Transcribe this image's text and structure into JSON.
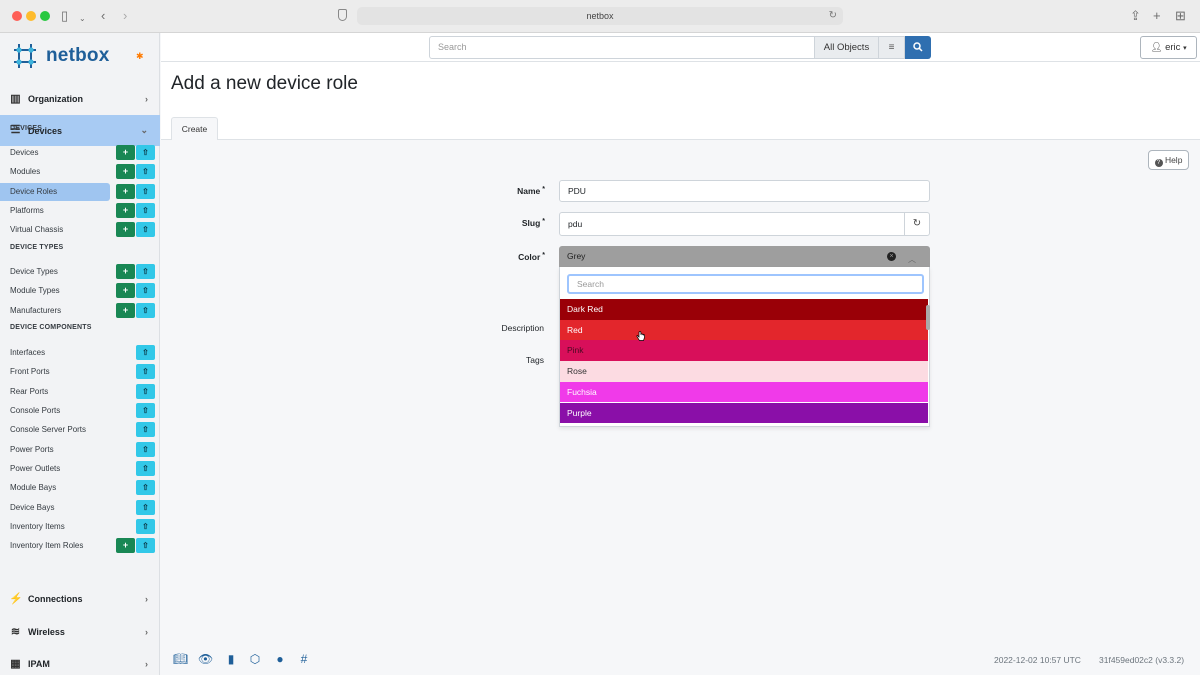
{
  "browser": {
    "url": "netbox",
    "icons": [
      "sidebar-toggle-icon",
      "back-icon",
      "forward-icon",
      "share-icon",
      "new-tab-icon",
      "tabs-overview-icon"
    ]
  },
  "logo": {
    "text": "netbox"
  },
  "sidebar": {
    "organization": "Organization",
    "devices": "Devices",
    "connections": "Connections",
    "wireless": "Wireless",
    "ipam": "IPAM",
    "sections": [
      {
        "heading": "DEVICES",
        "items": [
          {
            "label": "Devices",
            "add": true
          },
          {
            "label": "Modules",
            "add": true
          },
          {
            "label": "Device Roles",
            "add": true,
            "selected": true
          },
          {
            "label": "Platforms",
            "add": true
          },
          {
            "label": "Virtual Chassis",
            "add": true
          }
        ]
      },
      {
        "heading": "DEVICE TYPES",
        "items": [
          {
            "label": "Device Types",
            "add": true
          },
          {
            "label": "Module Types",
            "add": true
          },
          {
            "label": "Manufacturers",
            "add": true
          }
        ]
      },
      {
        "heading": "DEVICE COMPONENTS",
        "items": [
          {
            "label": "Interfaces",
            "add": false
          },
          {
            "label": "Front Ports",
            "add": false
          },
          {
            "label": "Rear Ports",
            "add": false
          },
          {
            "label": "Console Ports",
            "add": false
          },
          {
            "label": "Console Server Ports",
            "add": false
          },
          {
            "label": "Power Ports",
            "add": false
          },
          {
            "label": "Power Outlets",
            "add": false
          },
          {
            "label": "Module Bays",
            "add": false
          },
          {
            "label": "Device Bays",
            "add": false
          },
          {
            "label": "Inventory Items",
            "add": false
          },
          {
            "label": "Inventory Item Roles",
            "add": true
          }
        ]
      }
    ]
  },
  "topbar": {
    "search_placeholder": "Search",
    "scope": "All Objects",
    "user": "eric"
  },
  "page": {
    "title": "Add a new device role",
    "tab": "Create",
    "help": "Help"
  },
  "form": {
    "name_label": "Name",
    "name_value": "PDU",
    "slug_label": "Slug",
    "slug_value": "pdu",
    "color_label": "Color",
    "color_value": "Grey",
    "description_label": "Description",
    "tags_label": "Tags",
    "required_mark": "*"
  },
  "dropdown": {
    "search_placeholder": "Search",
    "options": [
      {
        "label": "Dark Red",
        "bg": "#9a0007",
        "fg": "#ffffff"
      },
      {
        "label": "Red",
        "bg": "#e3262c",
        "fg": "#ffffff"
      },
      {
        "label": "Pink",
        "bg": "#d80f5a",
        "fg": "#4a0a22"
      },
      {
        "label": "Rose",
        "bg": "#fcdbe2",
        "fg": "#333333"
      },
      {
        "label": "Fuchsia",
        "bg": "#f03ae9",
        "fg": "#ffffff"
      },
      {
        "label": "Purple",
        "bg": "#8a0fa8",
        "fg": "#ffffff"
      }
    ]
  },
  "footer": {
    "timestamp": "2022-12-02 10:57 UTC",
    "version": "31f459ed02c2 (v3.3.2)",
    "icons": [
      "docs-icon",
      "api-icon",
      "book-icon",
      "graphql-icon",
      "github-icon",
      "slack-icon"
    ]
  },
  "colors": {
    "accent": "#2f6fb0",
    "active_menu": "#a8cbf3",
    "add_button": "#198754",
    "import_button": "#32c8e8",
    "select_grey": "#9e9e9e"
  }
}
